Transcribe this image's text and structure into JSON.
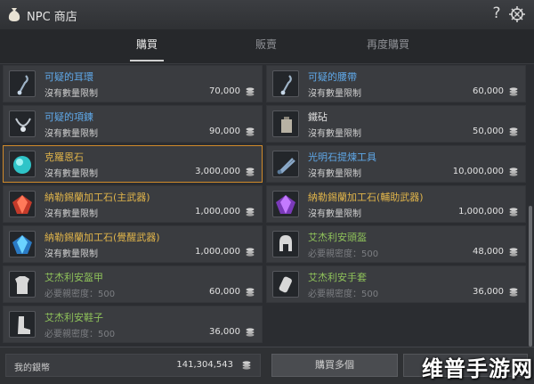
{
  "window": {
    "title": "NPC 商店",
    "help_label": "?"
  },
  "tabs": [
    {
      "label": "購買",
      "active": true
    },
    {
      "label": "販賣",
      "active": false
    },
    {
      "label": "再度購買",
      "active": false
    }
  ],
  "items": [
    {
      "name": "可疑的耳環",
      "name_color": "blue",
      "limit": "沒有數量限制",
      "limit_dim": false,
      "price": "70,000",
      "icon": "earring-icon",
      "selected": false
    },
    {
      "name": "可疑的腰帶",
      "name_color": "blue",
      "limit": "沒有數量限制",
      "limit_dim": false,
      "price": "60,000",
      "icon": "belt-icon",
      "selected": false
    },
    {
      "name": "可疑的項鍊",
      "name_color": "blue",
      "limit": "沒有數量限制",
      "limit_dim": false,
      "price": "90,000",
      "icon": "necklace-icon",
      "selected": false
    },
    {
      "name": "鐵砧",
      "name_color": "white",
      "limit": "沒有數量限制",
      "limit_dim": false,
      "price": "50,000",
      "icon": "anvil-icon",
      "selected": false
    },
    {
      "name": "克羅恩石",
      "name_color": "gold",
      "limit": "沒有數量限制",
      "limit_dim": false,
      "price": "3,000,000",
      "icon": "cron-stone-icon",
      "selected": true
    },
    {
      "name": "光明石提煉工具",
      "name_color": "blue",
      "limit": "沒有數量限制",
      "limit_dim": false,
      "price": "10,000,000",
      "icon": "tongs-icon",
      "selected": false
    },
    {
      "name": "納勒錫蘭加工石(主武器)",
      "name_color": "gold",
      "limit": "沒有數量限制",
      "limit_dim": false,
      "price": "1,000,000",
      "icon": "red-gem-icon",
      "selected": false
    },
    {
      "name": "納勒錫蘭加工石(輔助武器)",
      "name_color": "gold",
      "limit": "沒有數量限制",
      "limit_dim": false,
      "price": "1,000,000",
      "icon": "purple-gem-icon",
      "selected": false
    },
    {
      "name": "納勒錫蘭加工石(覺醒武器)",
      "name_color": "gold",
      "limit": "沒有數量限制",
      "limit_dim": false,
      "price": "1,000,000",
      "icon": "blue-gem-icon",
      "selected": false
    },
    {
      "name": "艾杰利安頭盔",
      "name_color": "green",
      "limit": "必要親密度：500",
      "limit_dim": true,
      "price": "48,000",
      "icon": "helmet-icon",
      "selected": false
    },
    {
      "name": "艾杰利安盔甲",
      "name_color": "green",
      "limit": "必要親密度：500",
      "limit_dim": true,
      "price": "60,000",
      "icon": "armor-icon",
      "selected": false
    },
    {
      "name": "艾杰利安手套",
      "name_color": "green",
      "limit": "必要親密度：500",
      "limit_dim": true,
      "price": "36,000",
      "icon": "gloves-icon",
      "selected": false
    },
    {
      "name": "艾杰利安鞋子",
      "name_color": "green",
      "limit": "必要親密度：500",
      "limit_dim": true,
      "price": "36,000",
      "icon": "boots-icon",
      "selected": false
    }
  ],
  "footer": {
    "money_label": "我的銀幣",
    "money_value": "141,304,543",
    "bulk_buy_label": "購買多個",
    "buy_label": ""
  },
  "watermark": "维普手游网",
  "colors": {
    "selected_border": "#d08a2a",
    "gold_name": "#e0b44a",
    "blue_name": "#5fa8e8",
    "green_name": "#8fc25a"
  }
}
